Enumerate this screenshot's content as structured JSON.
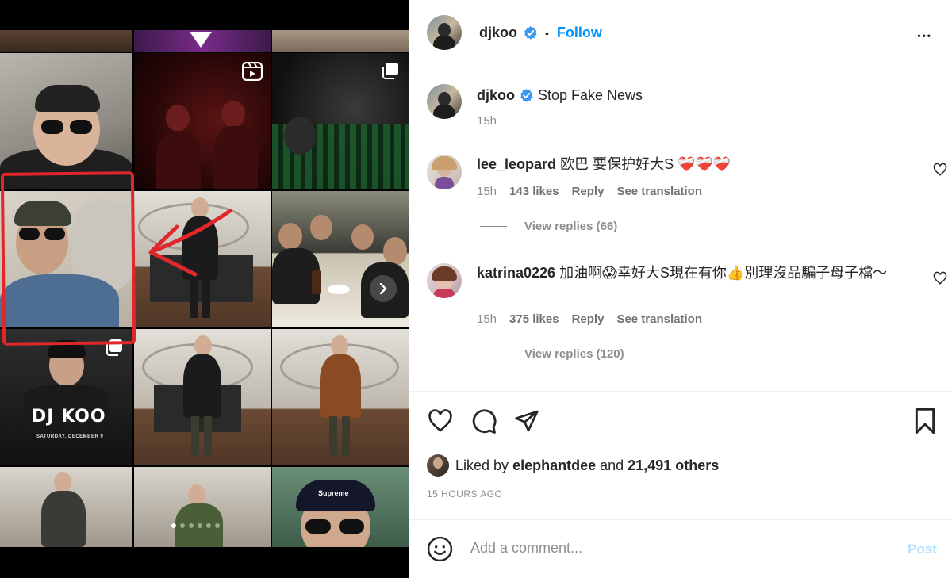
{
  "post": {
    "username": "djkoo",
    "verified": true,
    "follow_label": "Follow",
    "separator": "•",
    "more_label": "•••",
    "caption": "Stop Fake News",
    "caption_time": "15h"
  },
  "media": {
    "logo_text": "DJ KOO",
    "event_date": "SATURDAY, DECEMBER 9",
    "carousel_total": 6,
    "carousel_active": 1,
    "highlight_color": "#e0282c"
  },
  "comments": [
    {
      "username": "lee_leopard",
      "text": "欧巴 要保护好大S ❤️‍🩹❤️‍🩹❤️‍🩹",
      "time": "15h",
      "likes": "143 likes",
      "reply_label": "Reply",
      "translation_label": "See translation",
      "view_replies": "View replies (66)"
    },
    {
      "username": "katrina0226",
      "text": "加油啊😱幸好大S現在有你👍別理沒品騙子母子檔～",
      "time": "15h",
      "likes": "375 likes",
      "reply_label": "Reply",
      "translation_label": "See translation",
      "view_replies": "View replies (120)"
    }
  ],
  "likes": {
    "prefix": "Liked by",
    "user": "elephantdee",
    "and": "and",
    "others": "21,491 others"
  },
  "posted_ago": "15 HOURS AGO",
  "add_comment": {
    "placeholder": "Add a comment...",
    "post_label": "Post"
  },
  "colors": {
    "accent": "#0095f6",
    "verified": "#3897f0",
    "muted": "#8e8e8e",
    "post_disabled": "#b2dffc"
  }
}
